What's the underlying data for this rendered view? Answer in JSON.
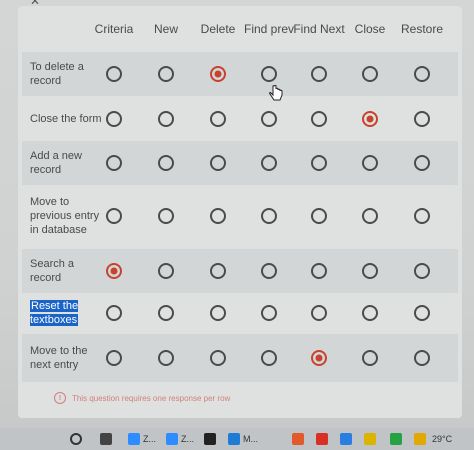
{
  "form": {
    "columns": [
      "Criteria",
      "New",
      "Delete",
      "Find prev",
      "Find Next",
      "Close",
      "Restore"
    ],
    "rows": [
      {
        "label": "To delete a record",
        "selected": 2
      },
      {
        "label": "Close the form",
        "selected": 5
      },
      {
        "label": "Add a new record",
        "selected": null
      },
      {
        "label": "Move to previous entry in database",
        "selected": null
      },
      {
        "label": "Search a record",
        "selected": 0
      },
      {
        "label": "Reset the textboxes",
        "selected": null,
        "highlighted": true
      },
      {
        "label": "Move to the next entry",
        "selected": 4
      }
    ],
    "validation_message": "This question requires one response per row",
    "validation_icon": "!"
  },
  "taskbar": {
    "items": [
      {
        "icon": "search-icon"
      },
      {
        "icon": "task-view-icon"
      },
      {
        "icon": "zoom-icon",
        "label": "Z..."
      },
      {
        "icon": "zoom-icon",
        "label": "Z..."
      },
      {
        "icon": "linux-icon"
      },
      {
        "icon": "edge-icon",
        "label": "M..."
      },
      {
        "icon": "app-icon"
      },
      {
        "icon": "app-icon"
      },
      {
        "icon": "mail-icon"
      },
      {
        "icon": "chrome-icon"
      },
      {
        "icon": "whatsapp-icon"
      },
      {
        "icon": "weather-icon"
      }
    ],
    "temperature": "29°C"
  },
  "colors": {
    "accent": "#c8432e",
    "highlight": "#1a63c7"
  }
}
